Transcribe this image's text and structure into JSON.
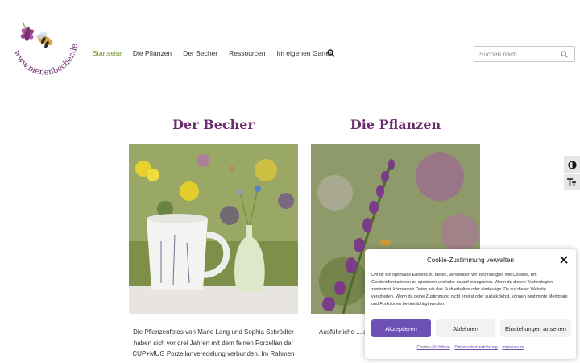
{
  "logo": {
    "text": "www.bienenbecher.de"
  },
  "nav": {
    "items": [
      {
        "label": "Startseite",
        "active": true
      },
      {
        "label": "Die Pflanzen"
      },
      {
        "label": "Der Becher"
      },
      {
        "label": "Ressourcen"
      },
      {
        "label": "Im eigenen Garten"
      }
    ],
    "search_icon": "search-icon"
  },
  "search": {
    "placeholder": "Suchen nach …"
  },
  "cards": [
    {
      "title": "Der Becher",
      "text": "Die Pflanzenfotos von Marie Lang und Sophia Schrödter haben sich vor drei Jahren mit dem feinen Porzellan der CUP+MUG Porzellanveredelung verbunden. Im Rahmen"
    },
    {
      "title": "Die Pflanzen",
      "text": "Ausführliche ... abgebildeten Pfla... mit Informatione..."
    }
  ],
  "a11y": {
    "contrast_icon": "contrast-icon",
    "font_icon": "font-size-icon"
  },
  "cookie": {
    "title": "Cookie-Zustimmung verwalten",
    "text": "Um dir ein optimales Erlebnis zu bieten, verwenden wir Technologien wie Cookies, um Geräteinformationen zu speichern und/oder darauf zuzugreifen. Wenn du diesen Technologien zustimmst, können wir Daten wie das Surfverhalten oder eindeutige IDs auf dieser Website verarbeiten. Wenn du deine Zustimmung nicht erteilst oder zurückziehst, können bestimmte Merkmale und Funktionen beeinträchtigt werden.",
    "accept": "Akzeptieren",
    "deny": "Ablehnen",
    "settings": "Einstellungen ansehen",
    "links": [
      "Cookie-Richtlinie",
      "Datenschutzerklärung",
      "Impressum"
    ]
  },
  "colors": {
    "accent": "#6b2d6e",
    "nav_active": "#6b8e23",
    "button": "#6c50b4"
  }
}
